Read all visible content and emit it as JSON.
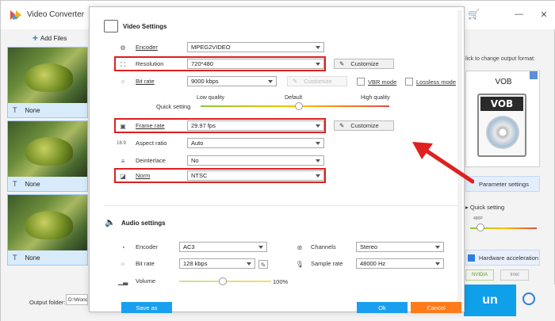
{
  "app": {
    "title": "Video Converter",
    "add_files_label": "Add Files",
    "minimize": "—",
    "close": "✕"
  },
  "files": [
    {
      "subtitle": "None"
    },
    {
      "subtitle": "None"
    },
    {
      "subtitle": "None"
    }
  ],
  "right_panel": {
    "hint": "lick to change output format:",
    "format": "VOB",
    "format_icon_text": "VOB",
    "parameter_settings": "Parameter settings",
    "quick_setting": "Quick setting",
    "quick_setting_value": "480P",
    "hardware_acceleration": "Hardware acceleration",
    "nvidia": "NVIDIA",
    "intel": "Intel"
  },
  "bottom": {
    "output_folder_label": "Output folder:",
    "output_folder_value": "D:\\Wond",
    "run_label": "un"
  },
  "dialog": {
    "video_title": "Video Settings",
    "audio_title": "Audio settings",
    "video": {
      "encoder_label": "Encoder",
      "encoder_value": "MPEG2VIDEO",
      "resolution_label": "Resolution",
      "resolution_value": "720*480",
      "bitrate_label": "Bit rate",
      "bitrate_value": "9000 kbps",
      "customize": "Customize",
      "vbr_mode": "VBR mode",
      "lossless_mode": "Lossless mode",
      "quick_setting": "Quick setting",
      "low_quality": "Low quality",
      "default": "Default",
      "high_quality": "High quality",
      "quality_level": 0.52,
      "framerate_label": "Frame rate",
      "framerate_value": "29.97 fps",
      "aspect_label": "Aspect ratio",
      "aspect_value": "Auto",
      "deinterlace_label": "Deinterlace",
      "deinterlace_value": "No",
      "norm_label": "Norm",
      "norm_value": "NTSC"
    },
    "audio": {
      "encoder_label": "Encoder",
      "encoder_value": "AC3",
      "channels_label": "Channels",
      "channels_value": "Stereo",
      "bitrate_label": "Bit rate",
      "bitrate_value": "128 kbps",
      "samplerate_label": "Sample rate",
      "samplerate_value": "48000 Hz",
      "volume_label": "Volume",
      "volume_value": "100%",
      "volume_level": 0.47
    },
    "buttons": {
      "save_as": "Save as",
      "ok": "Ok",
      "cancel": "Cancel"
    }
  },
  "colors": {
    "accent_blue": "#0fa0ea",
    "highlight_red": "#e01f1f",
    "cancel_orange": "#ff7a1a"
  }
}
